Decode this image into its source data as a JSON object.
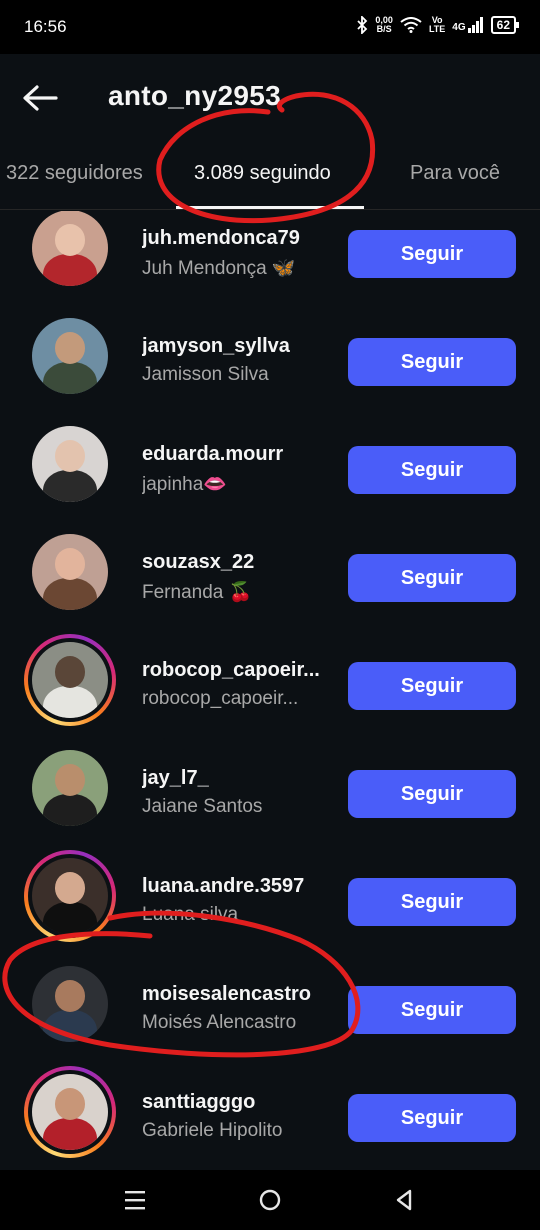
{
  "status_bar": {
    "time": "16:56",
    "speed_value": "0,00",
    "speed_unit": "B/S",
    "volte_top": "Vo",
    "volte_bottom": "LTE",
    "network": "4G",
    "battery": "62"
  },
  "header": {
    "back_icon": "arrow-left-icon",
    "username": "anto_ny2953"
  },
  "tabs": [
    {
      "label": "322 seguidores",
      "active": false
    },
    {
      "label": "3.089 seguindo",
      "active": true
    },
    {
      "label": "Para você",
      "active": false
    }
  ],
  "users": [
    {
      "username": "juh.mendonca79",
      "name": "Juh Mendonça 🦋",
      "button": "Seguir",
      "story": false,
      "colors": [
        "#c9a08f",
        "#b3262c",
        "#e8c2ab"
      ]
    },
    {
      "username": "jamyson_syllva",
      "name": "Jamisson Silva",
      "button": "Seguir",
      "story": false,
      "colors": [
        "#6e8ea3",
        "#3b4b3a",
        "#c39a7b"
      ]
    },
    {
      "username": "eduarda.mourr",
      "name": "japinha👄",
      "button": "Seguir",
      "story": false,
      "colors": [
        "#d8d4d2",
        "#2a2a2a",
        "#e3c3ae"
      ]
    },
    {
      "username": "souzasx_22",
      "name": "Fernanda 🍒",
      "button": "Seguir",
      "story": false,
      "colors": [
        "#bfa094",
        "#6b4733",
        "#e2b49c"
      ]
    },
    {
      "username": "robocop_capoeir...",
      "name": "robocop_capoeir...",
      "button": "Seguir",
      "story": true,
      "colors": [
        "#8b8e85",
        "#e5e5e0",
        "#5a4638"
      ]
    },
    {
      "username": "jay_l7_",
      "name": "Jaiane Santos",
      "button": "Seguir",
      "story": false,
      "colors": [
        "#8aa07a",
        "#1e1e1e",
        "#b98e6c"
      ]
    },
    {
      "username": "luana.andre.3597",
      "name": "Luana silva",
      "button": "Seguir",
      "story": true,
      "colors": [
        "#3b2f2a",
        "#0f0f0f",
        "#d4a98f"
      ]
    },
    {
      "username": "moisesalencastro",
      "name": "Moisés Alencastro",
      "button": "Seguir",
      "story": false,
      "colors": [
        "#2d3035",
        "#2b3a4f",
        "#a87a5e"
      ]
    },
    {
      "username": "santtiagggo",
      "name": "Gabriele Hipolito",
      "button": "Seguir",
      "story": true,
      "colors": [
        "#d9d2cc",
        "#b3202a",
        "#c89678"
      ]
    }
  ],
  "nav_bar": {
    "recents_icon": "menu-lines-icon",
    "home_icon": "circle-home-icon",
    "back_icon": "triangle-back-icon"
  },
  "colors": {
    "background": "#0c1014",
    "follow_button": "#4a5df9",
    "annotation": "#e01e1e"
  }
}
